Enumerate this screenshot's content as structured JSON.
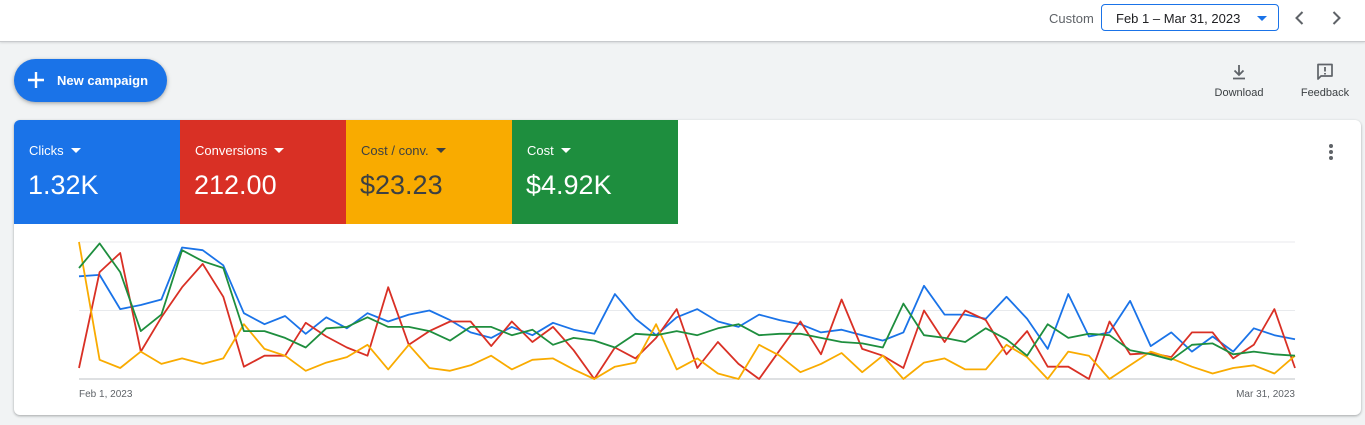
{
  "header": {
    "custom_label": "Custom",
    "date_range": "Feb 1 – Mar 31, 2023"
  },
  "actions": {
    "new_campaign": "New campaign",
    "download": "Download",
    "feedback": "Feedback"
  },
  "metrics": [
    {
      "name": "Clicks",
      "value": "1.32K",
      "color": "#1a73e8"
    },
    {
      "name": "Conversions",
      "value": "212.00",
      "color": "#d93025"
    },
    {
      "name": "Cost / conv.",
      "value": "$23.23",
      "color": "#f9ab00"
    },
    {
      "name": "Cost",
      "value": "$4.92K",
      "color": "#1e8e3e"
    }
  ],
  "chart_data": {
    "type": "line",
    "x_start_label": "Feb 1, 2023",
    "x_end_label": "Mar 31, 2023",
    "grid": true,
    "ylim": [
      0,
      1
    ],
    "series": [
      {
        "color": "#1a73e8",
        "values": [
          0.75,
          0.76,
          0.51,
          0.54,
          0.58,
          0.96,
          0.94,
          0.83,
          0.48,
          0.4,
          0.46,
          0.33,
          0.45,
          0.37,
          0.48,
          0.42,
          0.47,
          0.5,
          0.43,
          0.34,
          0.3,
          0.38,
          0.32,
          0.41,
          0.36,
          0.33,
          0.62,
          0.44,
          0.32,
          0.45,
          0.51,
          0.42,
          0.38,
          0.47,
          0.43,
          0.4,
          0.34,
          0.36,
          0.32,
          0.28,
          0.34,
          0.68,
          0.47,
          0.47,
          0.44,
          0.6,
          0.44,
          0.22,
          0.62,
          0.31,
          0.34,
          0.57,
          0.24,
          0.34,
          0.2,
          0.31,
          0.2,
          0.37,
          0.32,
          0.29
        ]
      },
      {
        "color": "#d93025",
        "values": [
          0.08,
          0.78,
          0.92,
          0.2,
          0.45,
          0.67,
          0.84,
          0.6,
          0.09,
          0.17,
          0.17,
          0.41,
          0.31,
          0.23,
          0.17,
          0.67,
          0.25,
          0.35,
          0.42,
          0.42,
          0.24,
          0.42,
          0.27,
          0.38,
          0.21,
          0.0,
          0.23,
          0.15,
          0.3,
          0.51,
          0.08,
          0.27,
          0.11,
          0.0,
          0.21,
          0.42,
          0.18,
          0.58,
          0.22,
          0.17,
          0.08,
          0.5,
          0.27,
          0.5,
          0.43,
          0.18,
          0.35,
          0.09,
          0.09,
          0.0,
          0.42,
          0.18,
          0.19,
          0.16,
          0.34,
          0.34,
          0.15,
          0.25,
          0.51,
          0.08
        ]
      },
      {
        "color": "#f9ab00",
        "values": [
          1.0,
          0.14,
          0.08,
          0.2,
          0.11,
          0.15,
          0.11,
          0.15,
          0.4,
          0.22,
          0.17,
          0.06,
          0.12,
          0.16,
          0.25,
          0.07,
          0.25,
          0.08,
          0.06,
          0.1,
          0.17,
          0.07,
          0.14,
          0.15,
          0.07,
          0.0,
          0.09,
          0.12,
          0.4,
          0.07,
          0.15,
          0.04,
          0.0,
          0.25,
          0.17,
          0.05,
          0.11,
          0.19,
          0.05,
          0.17,
          0.0,
          0.12,
          0.15,
          0.07,
          0.07,
          0.25,
          0.16,
          0.0,
          0.2,
          0.17,
          0.0,
          0.1,
          0.2,
          0.15,
          0.09,
          0.04,
          0.08,
          0.1,
          0.04,
          0.17
        ]
      },
      {
        "color": "#1e8e3e",
        "values": [
          0.81,
          0.99,
          0.78,
          0.35,
          0.47,
          0.94,
          0.86,
          0.81,
          0.35,
          0.35,
          0.3,
          0.23,
          0.37,
          0.38,
          0.45,
          0.38,
          0.38,
          0.35,
          0.28,
          0.38,
          0.38,
          0.32,
          0.36,
          0.25,
          0.3,
          0.28,
          0.23,
          0.33,
          0.32,
          0.35,
          0.32,
          0.37,
          0.4,
          0.32,
          0.33,
          0.33,
          0.3,
          0.27,
          0.26,
          0.23,
          0.55,
          0.32,
          0.3,
          0.27,
          0.37,
          0.29,
          0.17,
          0.4,
          0.3,
          0.33,
          0.32,
          0.21,
          0.18,
          0.14,
          0.25,
          0.26,
          0.18,
          0.2,
          0.18,
          0.17
        ]
      }
    ]
  }
}
